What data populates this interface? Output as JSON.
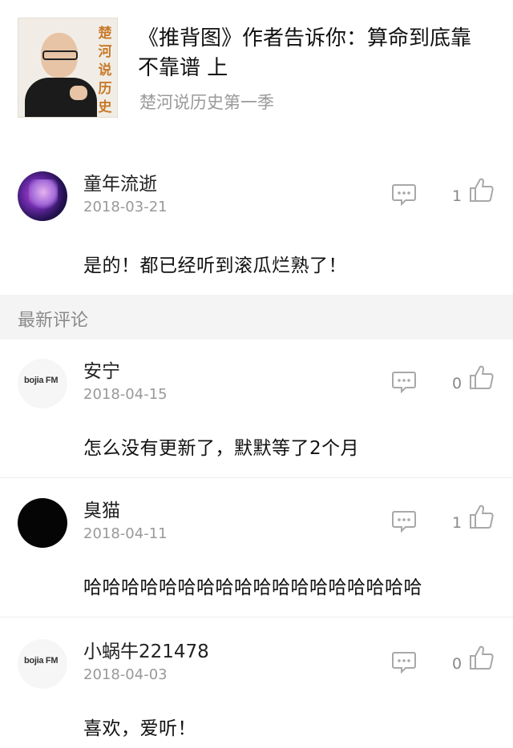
{
  "album": {
    "cover_text": "楚河说历史",
    "title": "《推背图》作者告诉你：算命到底靠不靠谱 上",
    "subtitle": "楚河说历史第一季"
  },
  "hot_comment": {
    "user": "童年流逝",
    "date": "2018-03-21",
    "likes": "1",
    "text": "是的！都已经听到滚瓜烂熟了！"
  },
  "section_label": "最新评论",
  "comments": [
    {
      "user": "安宁",
      "date": "2018-04-15",
      "likes": "0",
      "text": "怎么没有更新了，默默等了2个月",
      "avatar": "bojia-fm-logo"
    },
    {
      "user": "臭猫",
      "date": "2018-04-11",
      "likes": "1",
      "text": "哈哈哈哈哈哈哈哈哈哈哈哈哈哈哈哈哈哈",
      "avatar": "black-avatar"
    },
    {
      "user": "小蜗牛221478",
      "date": "2018-04-03",
      "likes": "0",
      "text": "喜欢，爱听！",
      "avatar": "bojia-fm-logo"
    }
  ],
  "logo_text": "bojia FM",
  "colors": {
    "muted": "#999999",
    "icon": "#a8a8a8",
    "section_bg": "#f4f4f4"
  },
  "icons": {
    "reply": "speech-bubble-icon",
    "like": "thumbs-up-icon"
  }
}
